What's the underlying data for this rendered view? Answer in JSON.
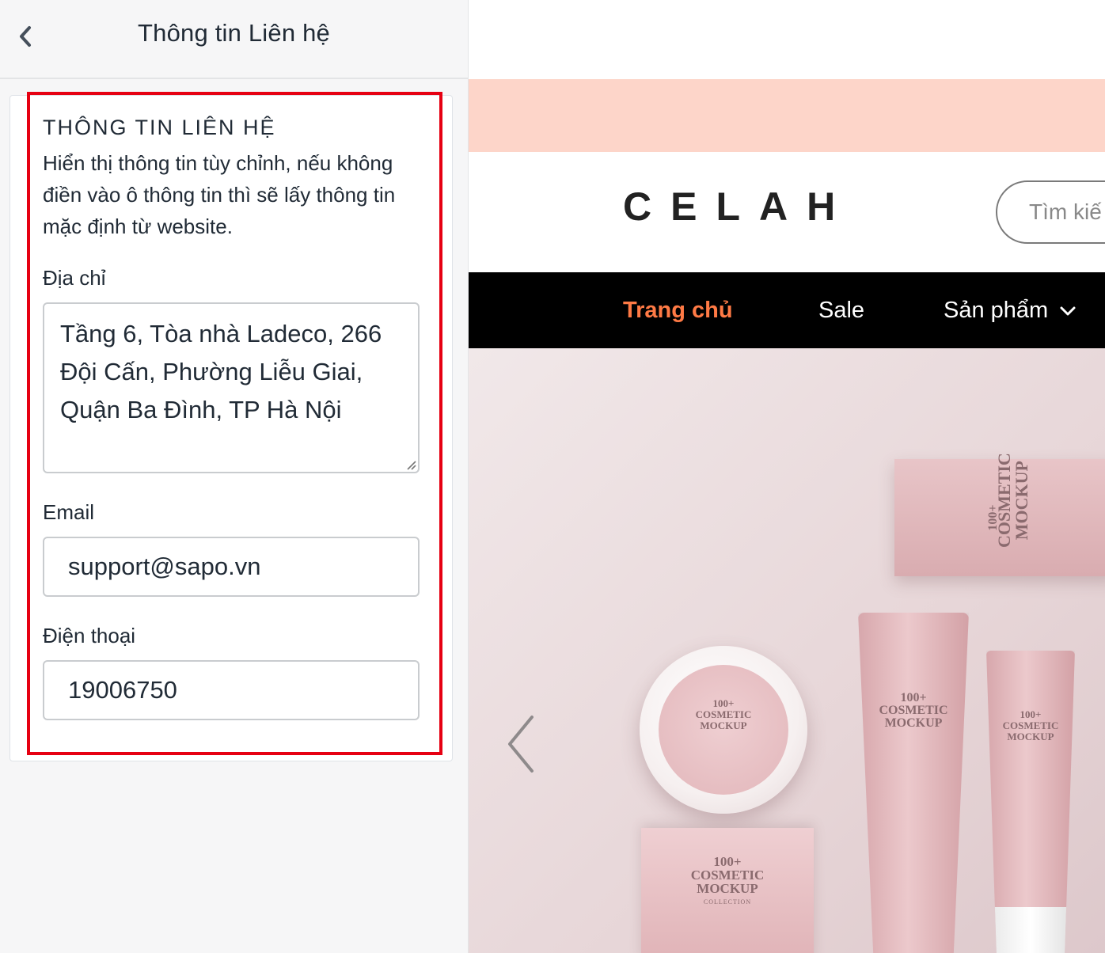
{
  "panel": {
    "title": "Thông tin Liên hệ",
    "back_icon": "chevron-left-icon"
  },
  "section": {
    "heading": "THÔNG TIN LIÊN HỆ",
    "description": "Hiển thị thông tin tùy chỉnh, nếu không điền vào ô thông tin thì sẽ lấy thông tin mặc định từ website.",
    "highlight_color": "#e60012"
  },
  "fields": {
    "address_label": "Địa chỉ",
    "address_value": "Tầng 6, Tòa nhà Ladeco, 266 Đội Cấn, Phường Liễu Giai, Quận Ba Đình, TP Hà Nội",
    "email_label": "Email",
    "email_value": "support@sapo.vn",
    "phone_label": "Điện thoại",
    "phone_value": "19006750"
  },
  "preview": {
    "promo_color": "#fdd5c9",
    "logo": "CELAH",
    "search_placeholder": "Tìm kiế",
    "nav": {
      "home": "Trang chủ",
      "sale": "Sale",
      "products": "Sản phẩm"
    },
    "accent": "#ff7a45",
    "hero_prev_icon": "chevron-left-icon",
    "product_text": {
      "count": "100+",
      "line1": "COSMETIC",
      "line2": "MOCKUP",
      "line3": "COLLECTION"
    }
  }
}
